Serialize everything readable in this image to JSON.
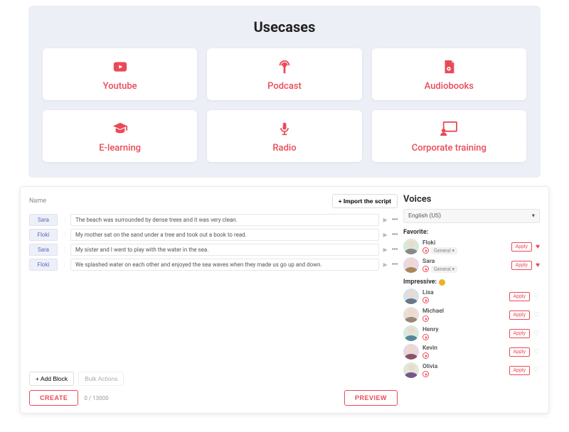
{
  "usecases": {
    "title": "Usecases",
    "cards": [
      {
        "label": "Youtube",
        "icon": "youtube"
      },
      {
        "label": "Podcast",
        "icon": "podcast"
      },
      {
        "label": "Audiobooks",
        "icon": "audiobook"
      },
      {
        "label": "E-learning",
        "icon": "elearning"
      },
      {
        "label": "Radio",
        "icon": "radio"
      },
      {
        "label": "Corporate training",
        "icon": "corporate"
      }
    ]
  },
  "editor": {
    "name_label": "Name",
    "import_btn": "+ Import the script",
    "lines": [
      {
        "speaker": "Sara",
        "text": "The beach was surrounded by dense trees and it was very clean."
      },
      {
        "speaker": "Floki",
        "text": "My mother sat on the sand under a tree and took out a book to read."
      },
      {
        "speaker": "Sara",
        "text": "My sister and I went to play with the water in the sea."
      },
      {
        "speaker": "Floki",
        "text": "We splashed water on each other and enjoyed the sea waves when they made us go up and down."
      }
    ],
    "add_block": "+  Add Block",
    "bulk_actions": "Bulk Actions",
    "create": "CREATE",
    "preview": "PREVIEW",
    "counter_used": "0",
    "counter_sep": " / ",
    "counter_total": "13000"
  },
  "voices": {
    "title": "Voices",
    "language": "English (US)",
    "favorite_label": "Favorite:",
    "impressive_label": "Impressive:",
    "general_tag": "General ▾",
    "apply": "Apply",
    "favorites": [
      {
        "name": "Floki",
        "has_general": true
      },
      {
        "name": "Sara",
        "has_general": true
      }
    ],
    "impressive": [
      {
        "name": "Lisa"
      },
      {
        "name": "Michael"
      },
      {
        "name": "Henry"
      },
      {
        "name": "Kevin"
      },
      {
        "name": "Olivia"
      }
    ]
  }
}
